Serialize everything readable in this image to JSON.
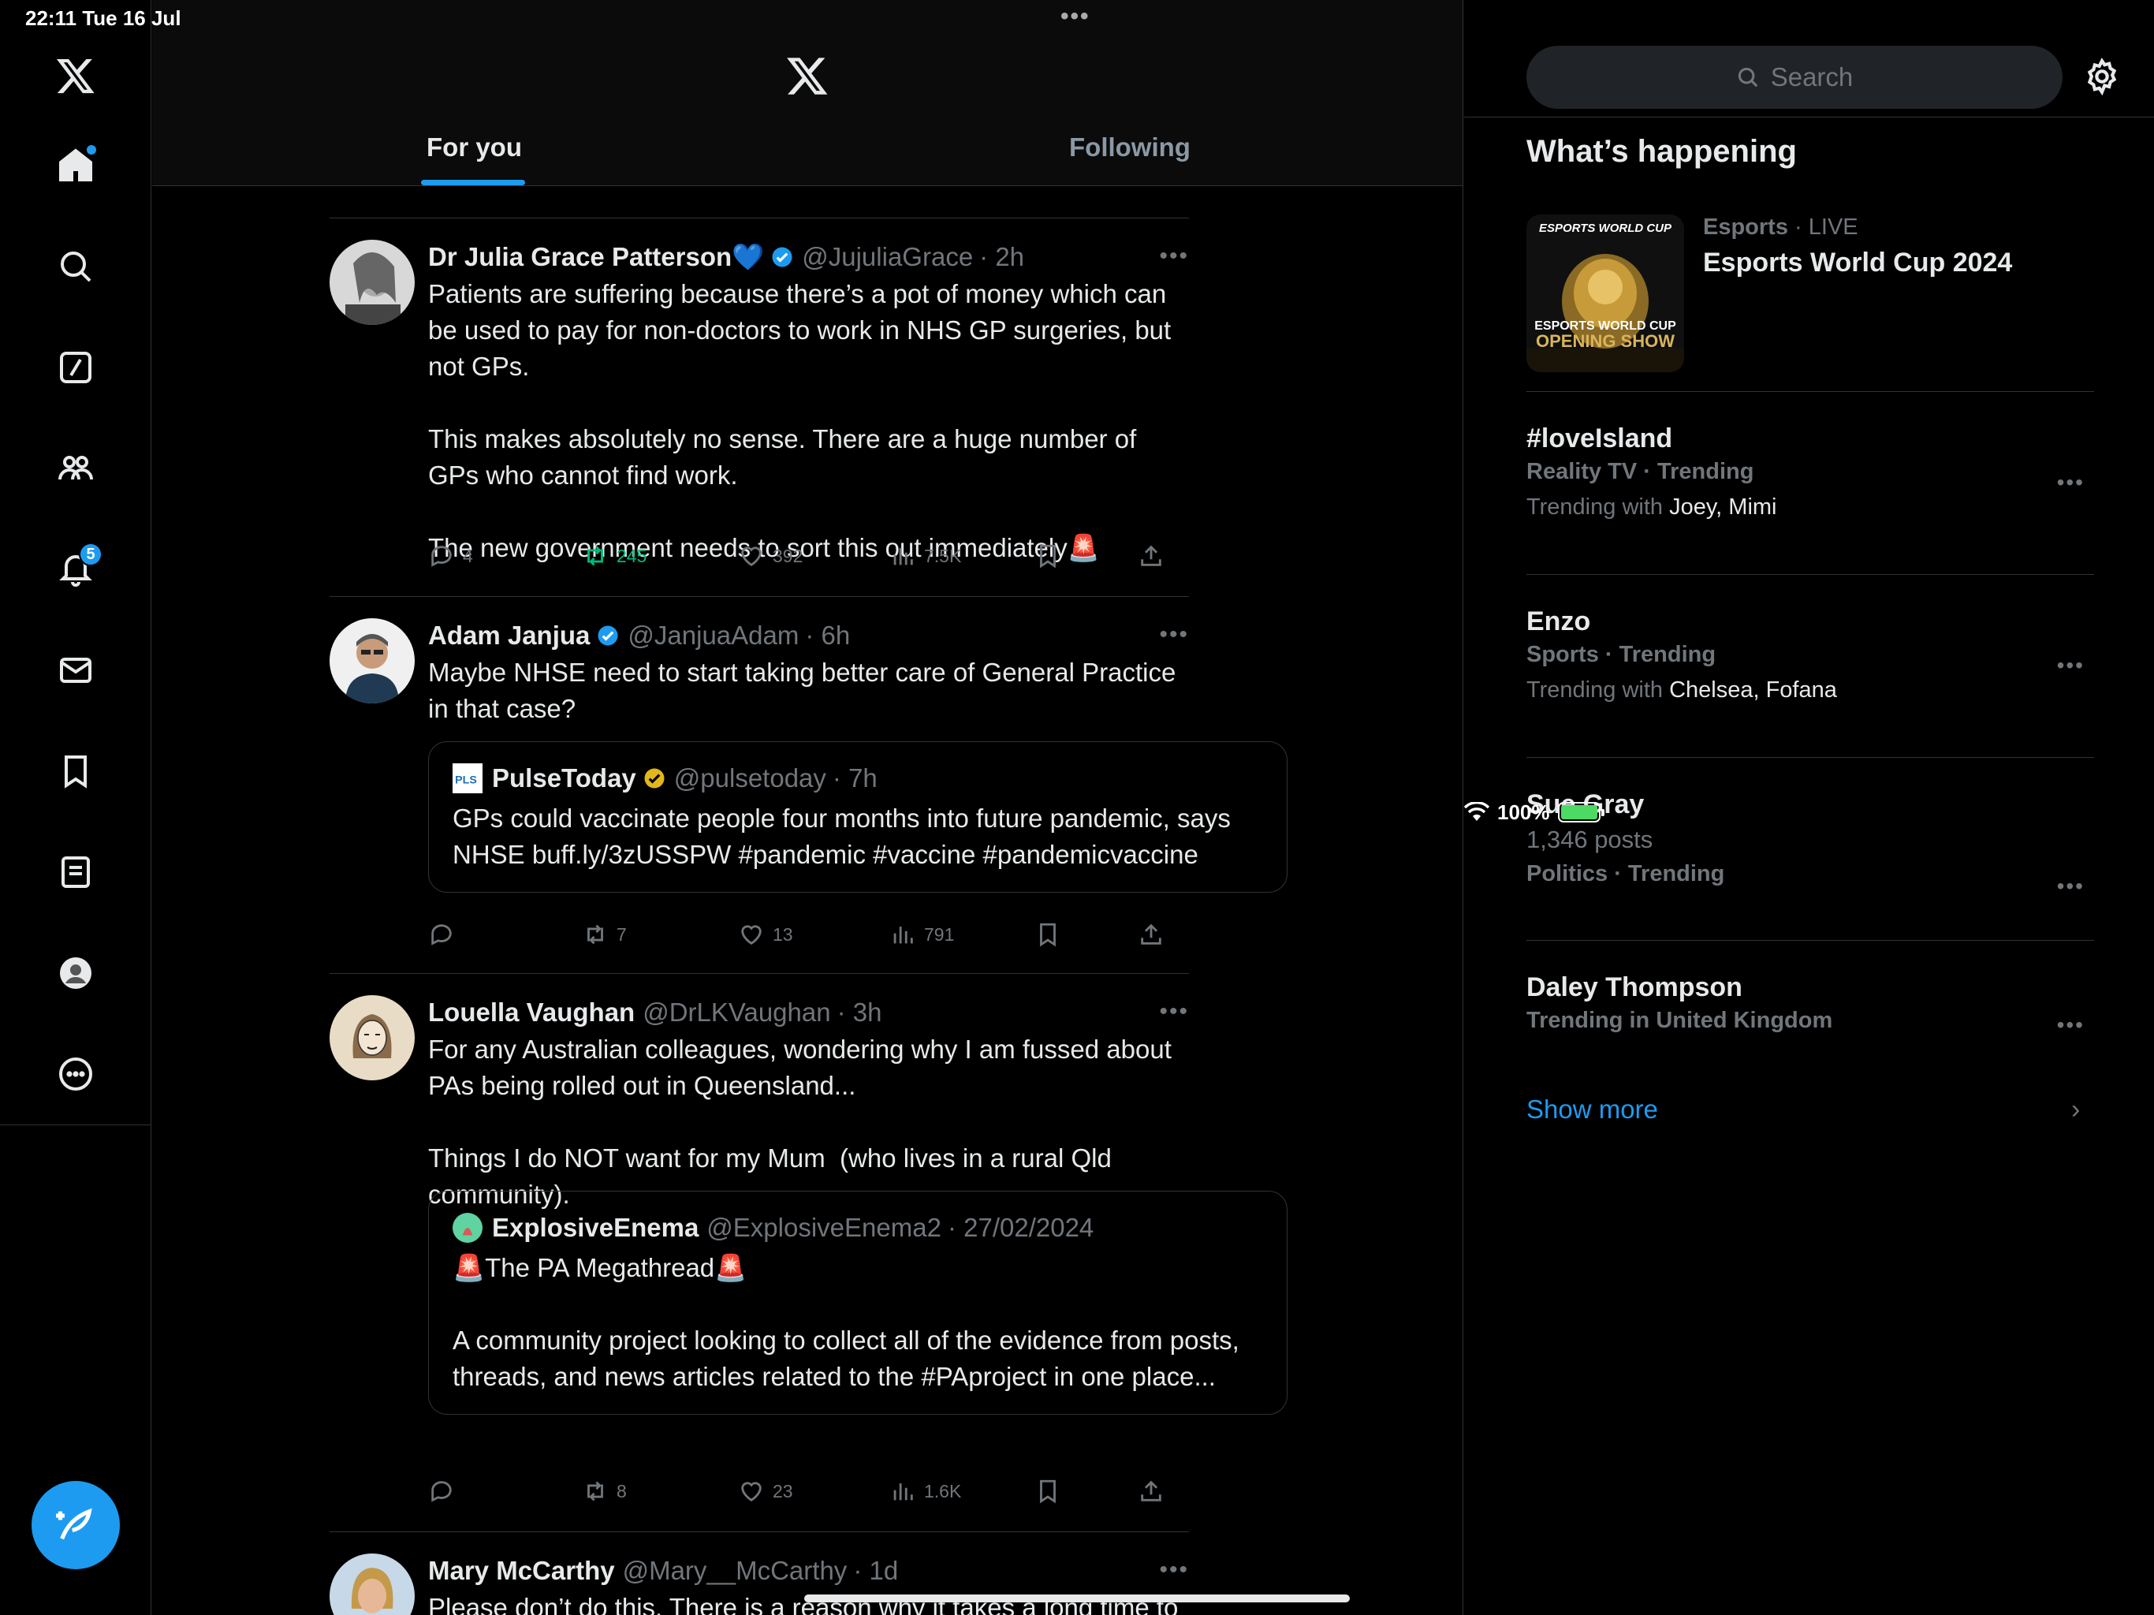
{
  "status_bar": {
    "time": "22:11",
    "date": "Tue 16 Jul",
    "battery": "100%"
  },
  "nav": {
    "items": [
      "home-icon",
      "search-icon",
      "grok-icon",
      "communities-icon",
      "notifications-icon",
      "messages-icon",
      "bookmarks-icon",
      "lists-icon",
      "profile-icon",
      "more-icon"
    ],
    "notifications_count": "5"
  },
  "tabs": {
    "for_you": "For you",
    "following": "Following"
  },
  "tweets": [
    {
      "name": "Dr Julia Grace Patterson",
      "name_emoji": "💙",
      "handle": "@JujuliaGrace",
      "time": "· 2h",
      "text": "Patients are suffering because there’s a pot of money which can be used to pay for non-doctors to work in NHS GP surgeries, but not GPs.\n\nThis makes absolutely no sense. There are a huge number of GPs who cannot find work.\n\nThe new government needs to sort this out immediately🚨",
      "replies": "4",
      "retweets": "245",
      "likes": "392",
      "views": "7.5K"
    },
    {
      "name": "Adam Janjua",
      "handle": "@JanjuaAdam",
      "time": "· 6h",
      "text": "Maybe NHSE need to start taking better care of General Practice in that case?",
      "quote": {
        "name": "PulseToday",
        "handle": "@pulsetoday",
        "time": "· 7h",
        "text": "GPs could vaccinate people four months into future pandemic, says NHSE buff.ly/3zUSSPW #pandemic #vaccine #pandemicvaccine"
      },
      "replies": "",
      "retweets": "7",
      "likes": "13",
      "views": "791"
    },
    {
      "name": "Louella Vaughan",
      "handle": "@DrLKVaughan",
      "time": "· 3h",
      "text": "For any Australian colleagues, wondering why I am fussed about PAs being rolled out in Queensland...\n\nThings I do NOT want for my Mum  (who lives in a rural Qld community).",
      "quote": {
        "name": "ExplosiveEnema",
        "handle": "@ExplosiveEnema2",
        "time": "· 27/02/2024",
        "text": "🚨The PA Megathread🚨\n\nA community project looking to collect all of the evidence from posts, threads, and news articles related to the #PAproject in one place..."
      },
      "replies": "",
      "retweets": "8",
      "likes": "23",
      "views": "1.6K"
    },
    {
      "name": "Mary McCarthy",
      "handle": "@Mary__McCarthy",
      "time": "· 1d",
      "text": "Please don’t do this. There is a reason why it takes a long time to train a"
    }
  ],
  "sidebar": {
    "search_placeholder": "Search",
    "title": "What’s happening",
    "event": {
      "category": "Esports",
      "status": "· LIVE",
      "title": "Esports World Cup 2024",
      "thumb_top": "ESPORTS WORLD CUP",
      "thumb_mid": "ESPORTS WORLD CUP",
      "thumb_bottom": "OPENING SHOW"
    },
    "trends": [
      {
        "title": "#loveIsland",
        "category": "Reality TV · Trending",
        "with_label": "Trending with ",
        "with": "Joey, Mimi"
      },
      {
        "title": "Enzo",
        "category": "Sports · Trending",
        "with_label": "Trending with ",
        "with": "Chelsea, Fofana"
      },
      {
        "title": "Sue Gray",
        "posts": "1,346 posts",
        "category": "Politics · Trending"
      },
      {
        "title": "Daley Thompson",
        "category": "Trending in United Kingdom"
      }
    ],
    "show_more": "Show more"
  },
  "colors": {
    "accent": "#1d9bf0",
    "retweet": "#00ba7c",
    "muted": "#71767b",
    "text": "#e7e9ea",
    "border": "#2f3336"
  }
}
